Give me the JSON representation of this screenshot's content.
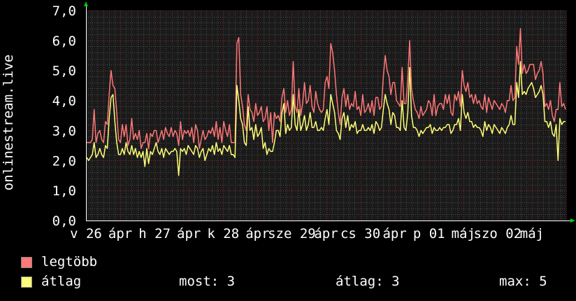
{
  "chart_data": {
    "type": "line",
    "ylabel": "onlinestream.live",
    "ylim": [
      0,
      7
    ],
    "y_ticks": [
      "0,0",
      "1,0",
      "2,0",
      "3,0",
      "4,0",
      "5,0",
      "6,0",
      "7,0"
    ],
    "x_tick_labels": [
      "v 26",
      "ápr",
      "h 27",
      "ápr",
      "k 28",
      "ápr",
      "sze 29",
      "ápr",
      "cs 30",
      "ápr",
      "p 01",
      "máj",
      "szo 02",
      "máj"
    ],
    "grid": true,
    "background": "#1a1a1a",
    "colors": {
      "max": "#ff7777",
      "avg": "#ffff77",
      "grid_major": "#8a2a2a",
      "grid_minor": "#4a4a4a",
      "axis": "#ffffff",
      "arrow": "#00cc00"
    },
    "series": [
      {
        "name": "legtöbb",
        "color": "#ff7777",
        "values": [
          2.6,
          2.6,
          2.6,
          2.7,
          3.7,
          2.6,
          2.9,
          3.0,
          2.7,
          2.6,
          3.3,
          3.2,
          4.2,
          5.0,
          4.5,
          4.4,
          3.6,
          2.7,
          2.6,
          3.2,
          2.8,
          3.2,
          2.5,
          2.7,
          3.4,
          2.7,
          2.9,
          2.7,
          3.0,
          2.4,
          2.6,
          2.6,
          2.9,
          2.4,
          2.9,
          2.8,
          3.0,
          3.0,
          2.6,
          2.8,
          3.0,
          2.7,
          3.1,
          2.9,
          2.8,
          3.1,
          2.8,
          3.0,
          2.9,
          2.5,
          3.3,
          2.7,
          3.0,
          2.9,
          3.0,
          2.8,
          3.1,
          2.6,
          3.2,
          3.0,
          2.4,
          2.7,
          3.0,
          2.7,
          2.8,
          3.0,
          2.9,
          3.1,
          2.8,
          3.3,
          2.7,
          3.1,
          2.6,
          3.3,
          3.0,
          2.8,
          3.2,
          2.6,
          2.6,
          2.6,
          5.9,
          6.1,
          4.2,
          3.8,
          3.2,
          3.0,
          4.2,
          3.7,
          3.6,
          3.3,
          3.9,
          3.5,
          3.6,
          3.8,
          3.3,
          3.4,
          3.8,
          3.0,
          3.6,
          2.6,
          3.6,
          3.4,
          3.5,
          3.3,
          4.1,
          4.4,
          3.6,
          4.0,
          3.5,
          3.7,
          5.3,
          3.8,
          3.6,
          4.4,
          3.5,
          3.9,
          4.6,
          3.9,
          4.0,
          4.5,
          3.8,
          3.6,
          4.3,
          3.9,
          3.7,
          3.6,
          3.7,
          4.6,
          4.8,
          4.4,
          5.9,
          5.6,
          5.0,
          4.2,
          3.6,
          3.2,
          4.1,
          4.4,
          3.8,
          4.2,
          3.7,
          3.9,
          3.8,
          4.3,
          3.7,
          3.8,
          3.5,
          4.2,
          3.6,
          3.7,
          3.9,
          3.6,
          4.0,
          3.5,
          4.1,
          4.1,
          3.7,
          3.8,
          4.8,
          5.5,
          5.0,
          4.8,
          4.2,
          4.6,
          4.6,
          4.0,
          3.9,
          3.8,
          5.1,
          3.9,
          3.9,
          4.7,
          6.0,
          4.4,
          4.0,
          3.7,
          3.6,
          3.4,
          3.8,
          3.5,
          3.6,
          3.7,
          4.0,
          3.9,
          3.5,
          4.2,
          3.5,
          3.8,
          3.9,
          3.9,
          3.7,
          4.2,
          3.9,
          4.2,
          3.6,
          3.5,
          4.2,
          4.0,
          4.3,
          3.8,
          5.0,
          4.5,
          4.3,
          4.6,
          4.1,
          4.2,
          3.9,
          4.2,
          3.9,
          4.0,
          3.8,
          3.7,
          4.2,
          3.6,
          4.1,
          3.9,
          3.7,
          4.0,
          3.9,
          3.8,
          3.7,
          3.9,
          3.8,
          3.6,
          4.0,
          4.0,
          4.5,
          4.0,
          4.1,
          5.8,
          5.2,
          6.4,
          4.9,
          5.2,
          4.9,
          5.0,
          5.2,
          5.2,
          5.2,
          4.7,
          4.9,
          5.0,
          5.3,
          4.9,
          3.8,
          3.9,
          3.7,
          4.0,
          3.5,
          3.3,
          3.7,
          3.7,
          4.6,
          3.8,
          3.9,
          3.7
        ]
      },
      {
        "name": "átlag",
        "color": "#ffff77",
        "values": [
          2.1,
          2.0,
          2.1,
          2.2,
          2.6,
          2.1,
          2.2,
          2.4,
          2.2,
          2.1,
          2.5,
          2.4,
          3.4,
          4.1,
          4.2,
          3.3,
          2.6,
          2.2,
          2.2,
          2.4,
          2.2,
          2.6,
          2.3,
          2.2,
          2.5,
          2.2,
          2.4,
          2.1,
          2.3,
          2.1,
          2.3,
          1.8,
          2.4,
          1.9,
          2.3,
          2.2,
          2.4,
          2.6,
          2.3,
          2.2,
          2.4,
          2.1,
          2.4,
          2.3,
          2.2,
          2.3,
          2.3,
          2.4,
          2.3,
          1.5,
          2.4,
          2.3,
          2.4,
          2.2,
          2.5,
          2.4,
          2.3,
          2.2,
          2.5,
          2.4,
          2.1,
          2.3,
          2.4,
          2.0,
          2.2,
          2.4,
          2.3,
          2.5,
          2.2,
          2.6,
          2.3,
          2.4,
          2.2,
          2.5,
          2.4,
          2.3,
          2.5,
          2.2,
          2.2,
          2.1,
          4.5,
          4.0,
          3.4,
          3.2,
          2.6,
          2.5,
          3.8,
          3.0,
          3.1,
          2.7,
          3.2,
          2.8,
          2.9,
          3.1,
          2.4,
          2.6,
          2.2,
          2.4,
          2.3,
          2.3,
          2.6,
          3.0,
          3.0,
          2.8,
          3.6,
          3.9,
          2.9,
          3.2,
          3.0,
          3.1,
          4.2,
          3.2,
          3.0,
          3.7,
          3.0,
          3.2,
          3.5,
          3.0,
          3.2,
          3.6,
          3.1,
          3.1,
          3.3,
          3.0,
          3.0,
          3.1,
          3.0,
          3.4,
          3.7,
          3.2,
          4.2,
          3.9,
          3.6,
          3.0,
          2.9,
          2.7,
          3.4,
          3.6,
          3.1,
          3.5,
          3.0,
          3.2,
          3.1,
          3.3,
          2.9,
          3.0,
          3.0,
          3.2,
          3.0,
          3.0,
          3.1,
          3.0,
          3.2,
          2.9,
          3.3,
          3.2,
          3.0,
          3.1,
          3.7,
          4.2,
          3.9,
          3.7,
          3.2,
          3.6,
          3.5,
          3.1,
          3.1,
          3.0,
          4.0,
          3.1,
          3.0,
          3.6,
          5.1,
          3.5,
          3.1,
          3.1,
          3.0,
          2.8,
          3.0,
          2.9,
          3.0,
          3.1,
          3.1,
          3.2,
          2.9,
          3.1,
          3.0,
          3.0,
          3.1,
          3.0,
          3.1,
          3.1,
          3.2,
          3.2,
          2.9,
          3.0,
          3.2,
          3.2,
          3.4,
          3.0,
          4.2,
          3.6,
          3.4,
          3.6,
          3.3,
          3.3,
          3.1,
          3.2,
          3.1,
          3.1,
          3.0,
          2.8,
          3.3,
          3.0,
          3.2,
          3.1,
          2.9,
          3.2,
          3.1,
          3.0,
          2.9,
          3.1,
          3.0,
          2.9,
          3.1,
          3.2,
          3.5,
          3.2,
          3.2,
          4.6,
          4.1,
          5.3,
          4.2,
          4.3,
          4.2,
          4.4,
          4.5,
          4.6,
          4.4,
          4.1,
          4.2,
          4.3,
          4.5,
          4.2,
          3.3,
          3.3,
          3.1,
          3.3,
          2.9,
          2.8,
          3.2,
          2.0,
          3.4,
          3.2,
          3.3,
          3.3
        ]
      }
    ]
  },
  "legend": [
    {
      "label": "legtöbb",
      "color": "#ff7777"
    },
    {
      "label": "átlag",
      "color": "#ffff77"
    }
  ],
  "stats": {
    "now": "most: 3",
    "avg": "átlag: 3",
    "max": "max: 5"
  }
}
